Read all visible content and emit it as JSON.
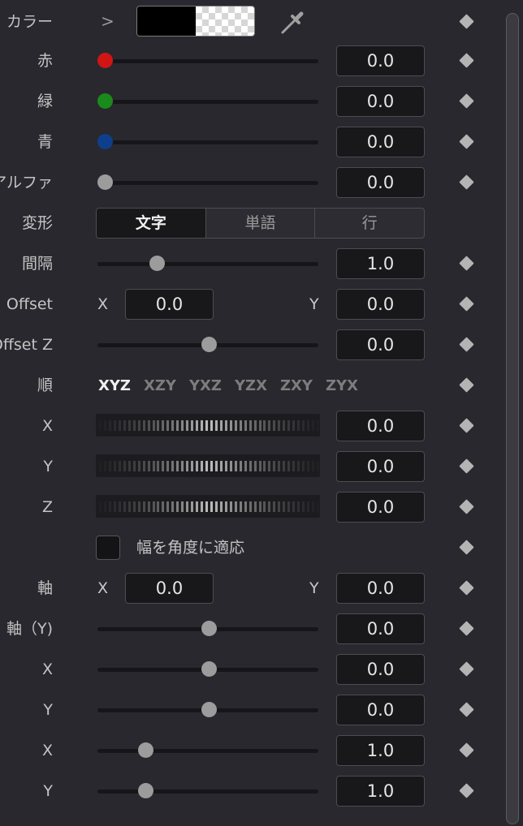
{
  "color": {
    "label": "カラー",
    "chevron": ">",
    "swatch_color": "#000000",
    "picker_icon": "eyedropper-icon"
  },
  "red": {
    "label": "赤",
    "value": "0.0",
    "knob_color": "#d01515"
  },
  "green": {
    "label": "緑",
    "value": "0.0",
    "knob_color": "#1a8a1a"
  },
  "blue": {
    "label": "青",
    "value": "0.0",
    "knob_color": "#0e3f8c"
  },
  "alpha": {
    "label": "アルファ",
    "value": "0.0"
  },
  "transform": {
    "label": "変形",
    "options": [
      "文字",
      "単語",
      "行"
    ],
    "selected": "文字"
  },
  "spacing": {
    "label": "間隔",
    "value": "1.0"
  },
  "offset": {
    "label": "Offset",
    "x_label": "X",
    "x_value": "0.0",
    "y_label": "Y",
    "y_value": "0.0"
  },
  "offset_z": {
    "label": "Offset Z",
    "value": "0.0"
  },
  "order": {
    "label": "順",
    "options": [
      "XYZ",
      "XZY",
      "YXZ",
      "YZX",
      "ZXY",
      "ZYX"
    ],
    "selected": "XYZ"
  },
  "rot_x": {
    "label": "X",
    "value": "0.0"
  },
  "rot_y": {
    "label": "Y",
    "value": "0.0"
  },
  "rot_z": {
    "label": "Z",
    "value": "0.0"
  },
  "fit_width": {
    "label": "幅を角度に適応",
    "checked": false
  },
  "axis": {
    "label": "軸",
    "x_label": "X",
    "x_value": "0.0",
    "y_label": "Y",
    "y_value": "0.0"
  },
  "axis_y": {
    "label": "軸（Y)",
    "value": "0.0"
  },
  "row_x1": {
    "label": "X",
    "value": "0.0"
  },
  "row_y1": {
    "label": "Y",
    "value": "0.0"
  },
  "row_x2": {
    "label": "X",
    "value": "1.0"
  },
  "row_y2": {
    "label": "Y",
    "value": "1.0"
  },
  "keyframe_icon": "keyframe-diamond-icon"
}
